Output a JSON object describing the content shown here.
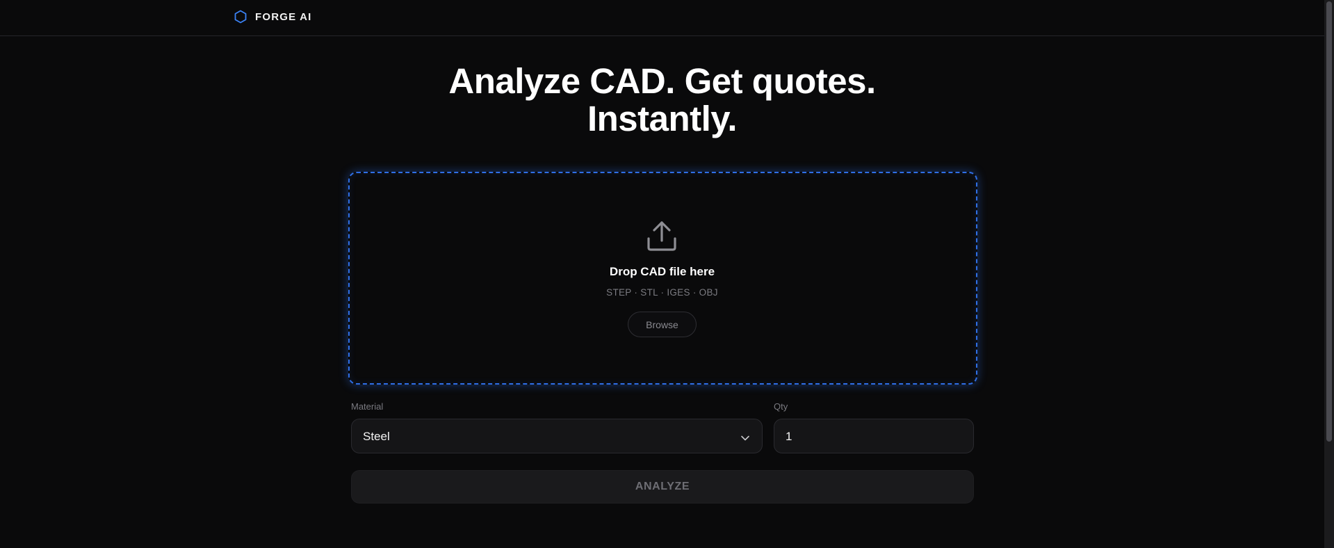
{
  "brand": {
    "name": "FORGE AI",
    "icon": "hexagon-icon",
    "accent": "#3b82f6"
  },
  "hero": {
    "line1": "Analyze CAD. Get quotes.",
    "line2": "Instantly."
  },
  "dropzone": {
    "icon": "upload-icon",
    "title": "Drop CAD file here",
    "formats": "STEP · STL · IGES · OBJ",
    "browse_label": "Browse",
    "border_color": "#2f6fe6"
  },
  "form": {
    "material_label": "Material",
    "material_value": "Steel",
    "qty_label": "Qty",
    "qty_value": "1",
    "analyze_label": "ANALYZE"
  }
}
